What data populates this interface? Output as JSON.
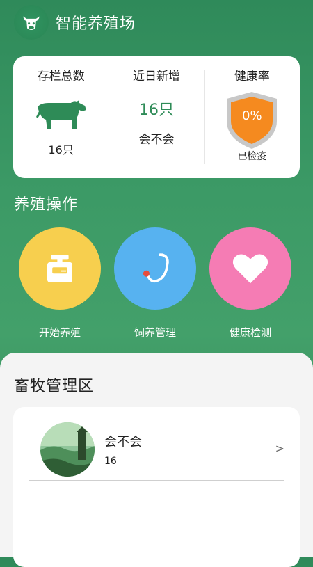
{
  "header": {
    "title": "智能养殖场",
    "logo_icon": "cow-head-icon"
  },
  "stats": {
    "stock": {
      "label": "存栏总数",
      "value": "16只",
      "icon": "cow-icon"
    },
    "recent": {
      "label": "近日新增",
      "value": "16只",
      "sub": "会不会"
    },
    "health": {
      "label": "健康率",
      "value": "0%",
      "note": "已检疫",
      "icon": "shield-icon"
    }
  },
  "operations": {
    "title": "养殖操作",
    "items": [
      {
        "label": "开始养殖",
        "icon": "scale-icon",
        "color": "#f7cf4e"
      },
      {
        "label": "饲养管理",
        "icon": "stethoscope-icon",
        "color": "#57b2f0"
      },
      {
        "label": "健康检测",
        "icon": "heart-icon",
        "color": "#f57cb4"
      }
    ]
  },
  "management": {
    "title": "畜牧管理区",
    "items": [
      {
        "name": "会不会",
        "count": "16",
        "chevron": ">"
      }
    ]
  },
  "colors": {
    "brand_green": "#2e8b57",
    "shield_orange": "#f58a1f"
  }
}
